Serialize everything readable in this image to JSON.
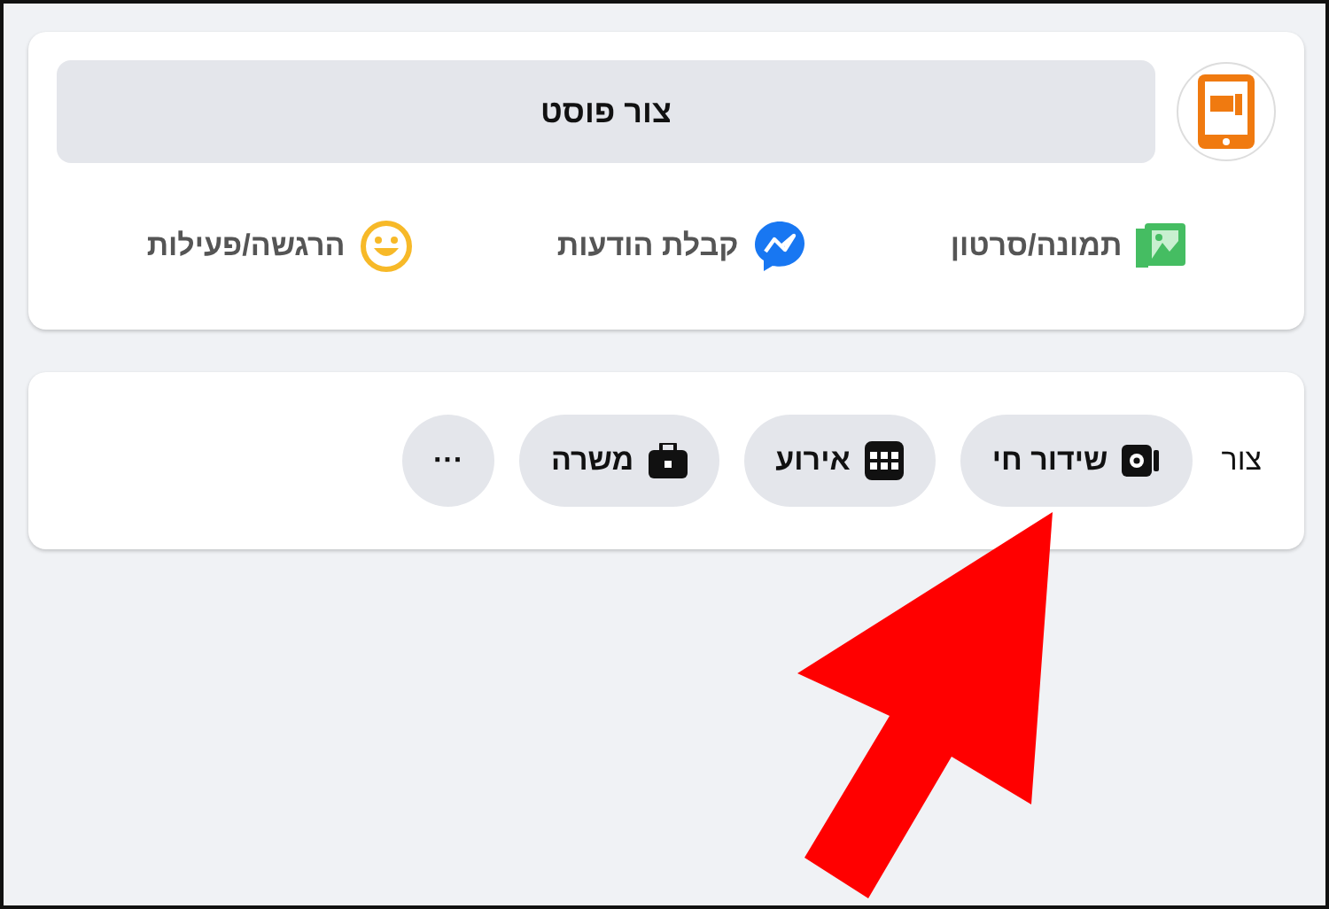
{
  "composer": {
    "prompt": "צור פוסט",
    "actions": [
      {
        "kind": "photo",
        "label": "תמונה/סרטון"
      },
      {
        "kind": "messenger",
        "label": "קבלת הודעות"
      },
      {
        "kind": "feeling",
        "label": "הרגשה/פעילות"
      }
    ]
  },
  "create_bar": {
    "label": "צור",
    "buttons": [
      {
        "kind": "live",
        "label": "שידור חי"
      },
      {
        "kind": "event",
        "label": "אירוע"
      },
      {
        "kind": "job",
        "label": "משרה"
      },
      {
        "kind": "more",
        "label": "···"
      }
    ]
  }
}
